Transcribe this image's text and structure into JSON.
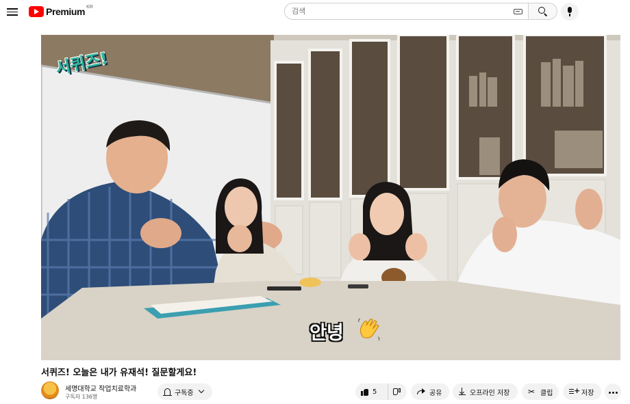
{
  "header": {
    "logo_text": "Premium",
    "logo_region": "KR",
    "search_placeholder": "검색"
  },
  "video": {
    "overlay_title": "서퀴즈!",
    "overlay_caption": "안녕"
  },
  "meta": {
    "title": "서퀴즈! 오늘은 내가 유재석! 질문할게요!",
    "channel_name": "세명대학교 작업치료학과",
    "subscriber_count": "구독자 136명"
  },
  "actions": {
    "subscribe_label": "구독중",
    "like_count": "5",
    "share_label": "공유",
    "offline_label": "오프라인 저장",
    "clip_label": "클립",
    "save_label": "저장"
  },
  "colors": {
    "brand_red": "#ff0000",
    "pill_bg": "#f2f2f2",
    "overlay_green": "#2fb59a"
  },
  "icons": [
    "menu-icon",
    "youtube-logo-icon",
    "keyboard-icon",
    "search-icon",
    "mic-icon",
    "bell-icon",
    "chevron-down-icon",
    "thumb-up-icon",
    "thumb-down-icon",
    "share-icon",
    "download-icon",
    "scissors-icon",
    "playlist-add-icon",
    "more-icon",
    "wave-hand-icon"
  ]
}
